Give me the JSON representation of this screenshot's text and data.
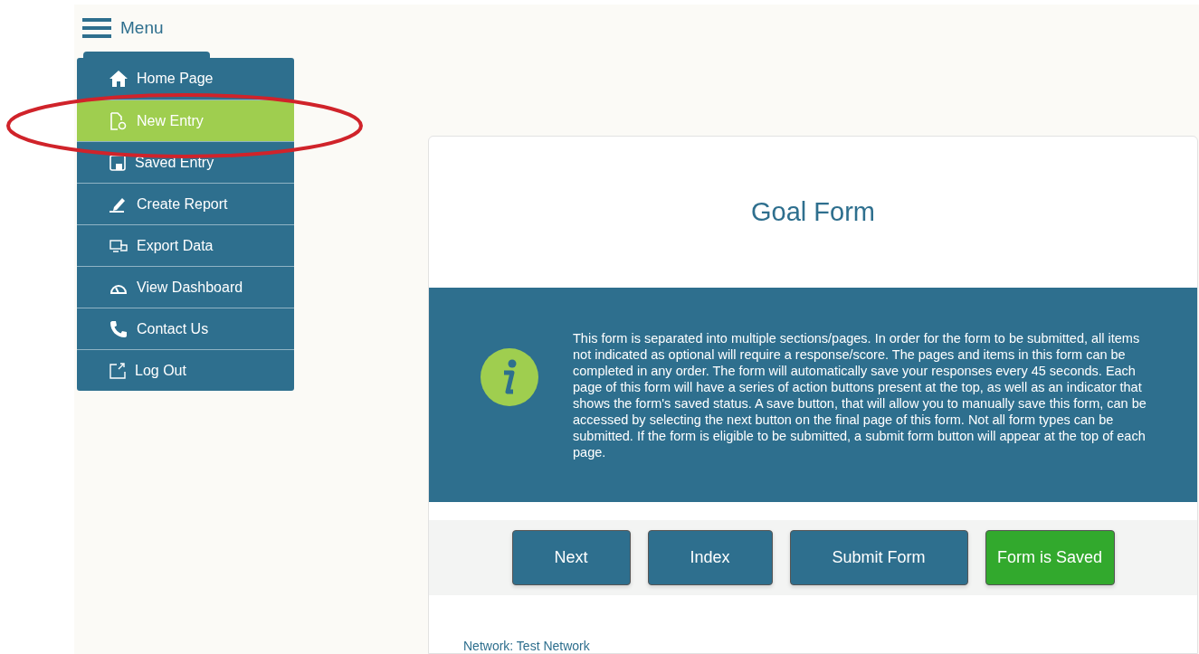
{
  "header": {
    "menu_label": "Menu"
  },
  "sidebar": {
    "items": [
      {
        "label": "Home Page",
        "selected": false
      },
      {
        "label": "New Entry",
        "selected": true
      },
      {
        "label": "Saved Entry",
        "selected": false
      },
      {
        "label": "Create Report",
        "selected": false
      },
      {
        "label": "Export Data",
        "selected": false
      },
      {
        "label": "View Dashboard",
        "selected": false
      },
      {
        "label": "Contact Us",
        "selected": false
      },
      {
        "label": "Log Out",
        "selected": false
      }
    ]
  },
  "form": {
    "title": "Goal Form",
    "info": "This form is separated into multiple sections/pages. In order for the form to be submitted, all items not indicated as optional will require a response/score. The pages and items in this form can be completed in any order. The form will automatically save your responses every 45 seconds. Each page of this form will have a series of action buttons present at the top, as well as an indicator that shows the form's saved status. A save button, that will allow you to manually save this form, can be accessed by selecting the next button on the final page of this form. Not all form types can be submitted. If the form is eligible to be submitted, a submit form button will appear at the top of each page.",
    "buttons": [
      {
        "label": "Next",
        "kind": "action"
      },
      {
        "label": "Index",
        "kind": "action"
      },
      {
        "label": "Submit Form",
        "kind": "action"
      },
      {
        "label": "Form is Saved",
        "kind": "status"
      }
    ],
    "network": "Network: Test Network"
  }
}
